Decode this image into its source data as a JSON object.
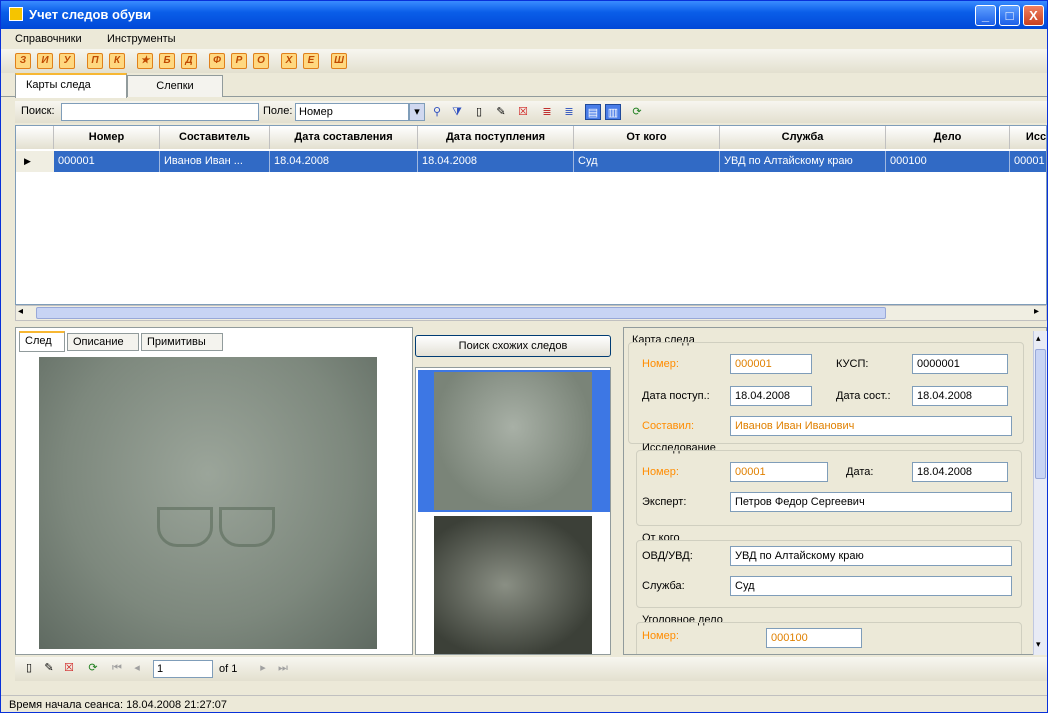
{
  "window": {
    "title": "Учет следов обуви",
    "minimize": "_",
    "maximize": "□",
    "close": "X"
  },
  "menu": [
    "Справочники",
    "Инструменты"
  ],
  "toolbar_letters": [
    "З",
    "И",
    "У",
    "П",
    "К",
    "★",
    "Б",
    "Д",
    "Ф",
    "Р",
    "О",
    "Х",
    "Е",
    "Ш"
  ],
  "tabs": [
    {
      "label": "Карты следа"
    },
    {
      "label": "Слепки"
    }
  ],
  "search": {
    "label": "Поиск:",
    "value": "",
    "field_label": "Поле:",
    "field_value": "Номер"
  },
  "grid": {
    "columns": [
      "Номер",
      "Составитель",
      "Дата составления",
      "Дата поступления",
      "От кого",
      "Служба",
      "Дело",
      "Иссл"
    ],
    "rows": [
      [
        "000001",
        "Иванов Иван ...",
        "18.04.2008",
        "18.04.2008",
        "Суд",
        "УВД по Алтайскому краю",
        "000100",
        "00001"
      ]
    ]
  },
  "subtabs": [
    "След",
    "Описание",
    "Примитивы"
  ],
  "find_similar_button": "Поиск схожих следов",
  "card": {
    "group_title": "Карта следа",
    "number_label": "Номер:",
    "number": "000001",
    "kusp_label": "КУСП:",
    "kusp": "0000001",
    "date_recv_label": "Дата поступ.:",
    "date_recv": "18.04.2008",
    "date_comp_label": "Дата сост.:",
    "date_comp": "18.04.2008",
    "composer_label": "Составил:",
    "composer": "Иванов Иван Иванович"
  },
  "research": {
    "group_title": "Исследование",
    "number_label": "Номер:",
    "number": "00001",
    "date_label": "Дата:",
    "date": "18.04.2008",
    "expert_label": "Эксперт:",
    "expert": "Петров Федор Сергеевич"
  },
  "from": {
    "group_title": "От кого",
    "ovd_label": "ОВД/УВД:",
    "ovd": "УВД по Алтайскому краю",
    "service_label": "Служба:",
    "service": "Суд"
  },
  "case": {
    "group_title": "Уголовное дело",
    "number_label": "Номер:",
    "number": "000100"
  },
  "navigator": {
    "position": "1",
    "of": "of 1"
  },
  "status": "Время начала сеанса: 18.04.2008 21:27:07"
}
